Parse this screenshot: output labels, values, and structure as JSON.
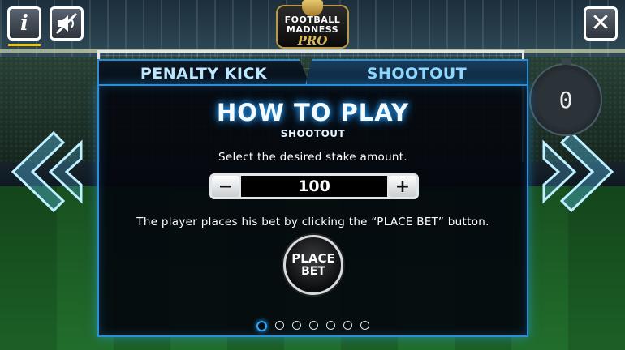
{
  "game": {
    "logo": {
      "line1": "FOOTBALL",
      "line2": "MADNESS",
      "line3": "PRO"
    },
    "timer_value": "0"
  },
  "top_bar": {
    "info_icon": "info-icon",
    "sound_icon": "sound-muted-icon",
    "close_icon": "close-icon",
    "info_glyph": "i",
    "close_glyph": "✕"
  },
  "help_panel": {
    "tabs": [
      {
        "label": "PENALTY KICK",
        "active": false
      },
      {
        "label": "SHOOTOUT",
        "active": true
      }
    ],
    "title": "HOW TO PLAY",
    "subtitle": "SHOOTOUT",
    "instruction_stake": "Select the desired stake amount.",
    "stake": {
      "minus": "−",
      "value": "100",
      "plus": "+"
    },
    "instruction_bet": "The player places his bet by clicking the “PLACE BET” button.",
    "place_bet": {
      "line1": "PLACE",
      "line2": "BET"
    },
    "pagination": {
      "pages": 7,
      "current": 1
    }
  },
  "colors": {
    "accent_blue": "#2aa6ff",
    "panel_border": "#2a8fd6",
    "arrow_cyan": "#5fd0ff",
    "highlight_yellow": "#f0c300"
  }
}
